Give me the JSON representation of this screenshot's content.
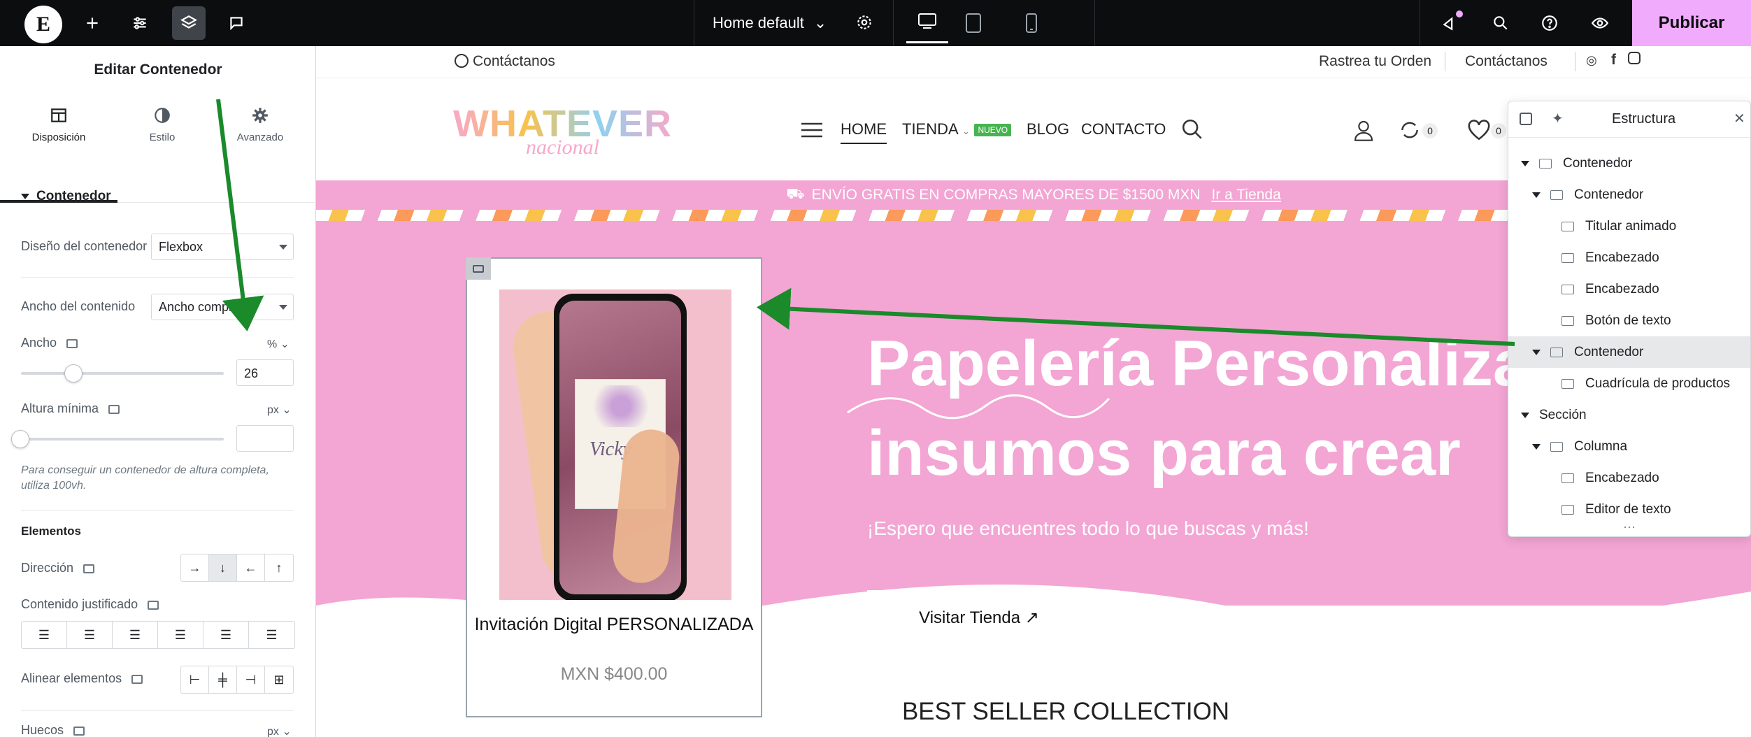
{
  "topbar": {
    "logo_letter": "E",
    "page_name": "Home default",
    "publish_label": "Publicar"
  },
  "panel": {
    "title": "Editar Contenedor",
    "tabs": [
      {
        "label": "Disposición",
        "icon": "layout-icon"
      },
      {
        "label": "Estilo",
        "icon": "contrast-icon"
      },
      {
        "label": "Avanzado",
        "icon": "gear-icon"
      }
    ],
    "section_title": "Contenedor",
    "container_layout_label": "Diseño del contenedor",
    "container_layout_value": "Flexbox",
    "content_width_label": "Ancho del contenido",
    "content_width_value": "Ancho completo",
    "width_label": "Ancho",
    "width_unit": "%",
    "width_value": "26",
    "min_height_label": "Altura mínima",
    "min_height_unit": "px",
    "min_height_value": "",
    "hint": "Para conseguir un contenedor de altura completa, utiliza 100vh.",
    "elements_title": "Elementos",
    "direction_label": "Dirección",
    "justify_label": "Contenido justificado",
    "align_label": "Alinear elementos",
    "gaps_label": "Huecos",
    "gaps_unit": "px",
    "direction_options": [
      "→",
      "↓",
      "←",
      "↑"
    ]
  },
  "site": {
    "contact_top": "Contáctanos",
    "track_order": "Rastrea tu Orden",
    "contact_link": "Contáctanos",
    "brand_main": "WHATEVER",
    "brand_sub": "nacional",
    "nav": [
      "HOME",
      "TIENDA",
      "BLOG",
      "CONTACTO"
    ],
    "nav_badge": "NUEVO",
    "compare_count": "0",
    "wishlist_count": "0",
    "banner_text": "ENVÍO GRATIS EN COMPRAS MAYORES DE $1500 MXN",
    "banner_link": "Ir a Tienda",
    "hero_title_1": "Papelería Personaliza",
    "hero_title_2": "insumos para crear",
    "hero_subtitle": "¡Espero que encuentres todo lo que buscas y más!",
    "hero_button": "Visitar Tienda ↗",
    "product_title": "Invitación Digital PERSONALIZADA",
    "product_price": "MXN $400.00",
    "invite_text": "Vicky",
    "best_seller": "BEST SELLER COLLECTION"
  },
  "structure": {
    "title": "Estructura",
    "items": [
      {
        "label": "Contenedor",
        "level": 0,
        "expand": true,
        "icon": "container-icon"
      },
      {
        "label": "Contenedor",
        "level": 1,
        "expand": true,
        "icon": "container-icon"
      },
      {
        "label": "Titular animado",
        "level": 2,
        "expand": false,
        "icon": "eye-icon"
      },
      {
        "label": "Encabezado",
        "level": 2,
        "expand": false,
        "icon": "heading-icon"
      },
      {
        "label": "Encabezado",
        "level": 2,
        "expand": false,
        "icon": "heading-icon"
      },
      {
        "label": "Botón de texto",
        "level": 2,
        "expand": false,
        "icon": "button-icon"
      },
      {
        "label": "Contenedor",
        "level": 1,
        "expand": true,
        "icon": "container-icon",
        "selected": true
      },
      {
        "label": "Cuadrícula de productos",
        "level": 2,
        "expand": false,
        "icon": "grid-icon"
      },
      {
        "label": "Sección",
        "level": 0,
        "expand": true,
        "icon": ""
      },
      {
        "label": "Columna",
        "level": 1,
        "expand": true,
        "icon": "column-icon"
      },
      {
        "label": "Encabezado",
        "level": 2,
        "expand": false,
        "icon": "heading-icon"
      },
      {
        "label": "Editor de texto",
        "level": 2,
        "expand": false,
        "icon": "text-editor-icon"
      }
    ]
  },
  "colors": {
    "topbar": "#0c0d0e",
    "publish": "#f0abfc",
    "hero_pink": "#f3a5d3",
    "annotation_arrow": "#1a8a2a"
  }
}
